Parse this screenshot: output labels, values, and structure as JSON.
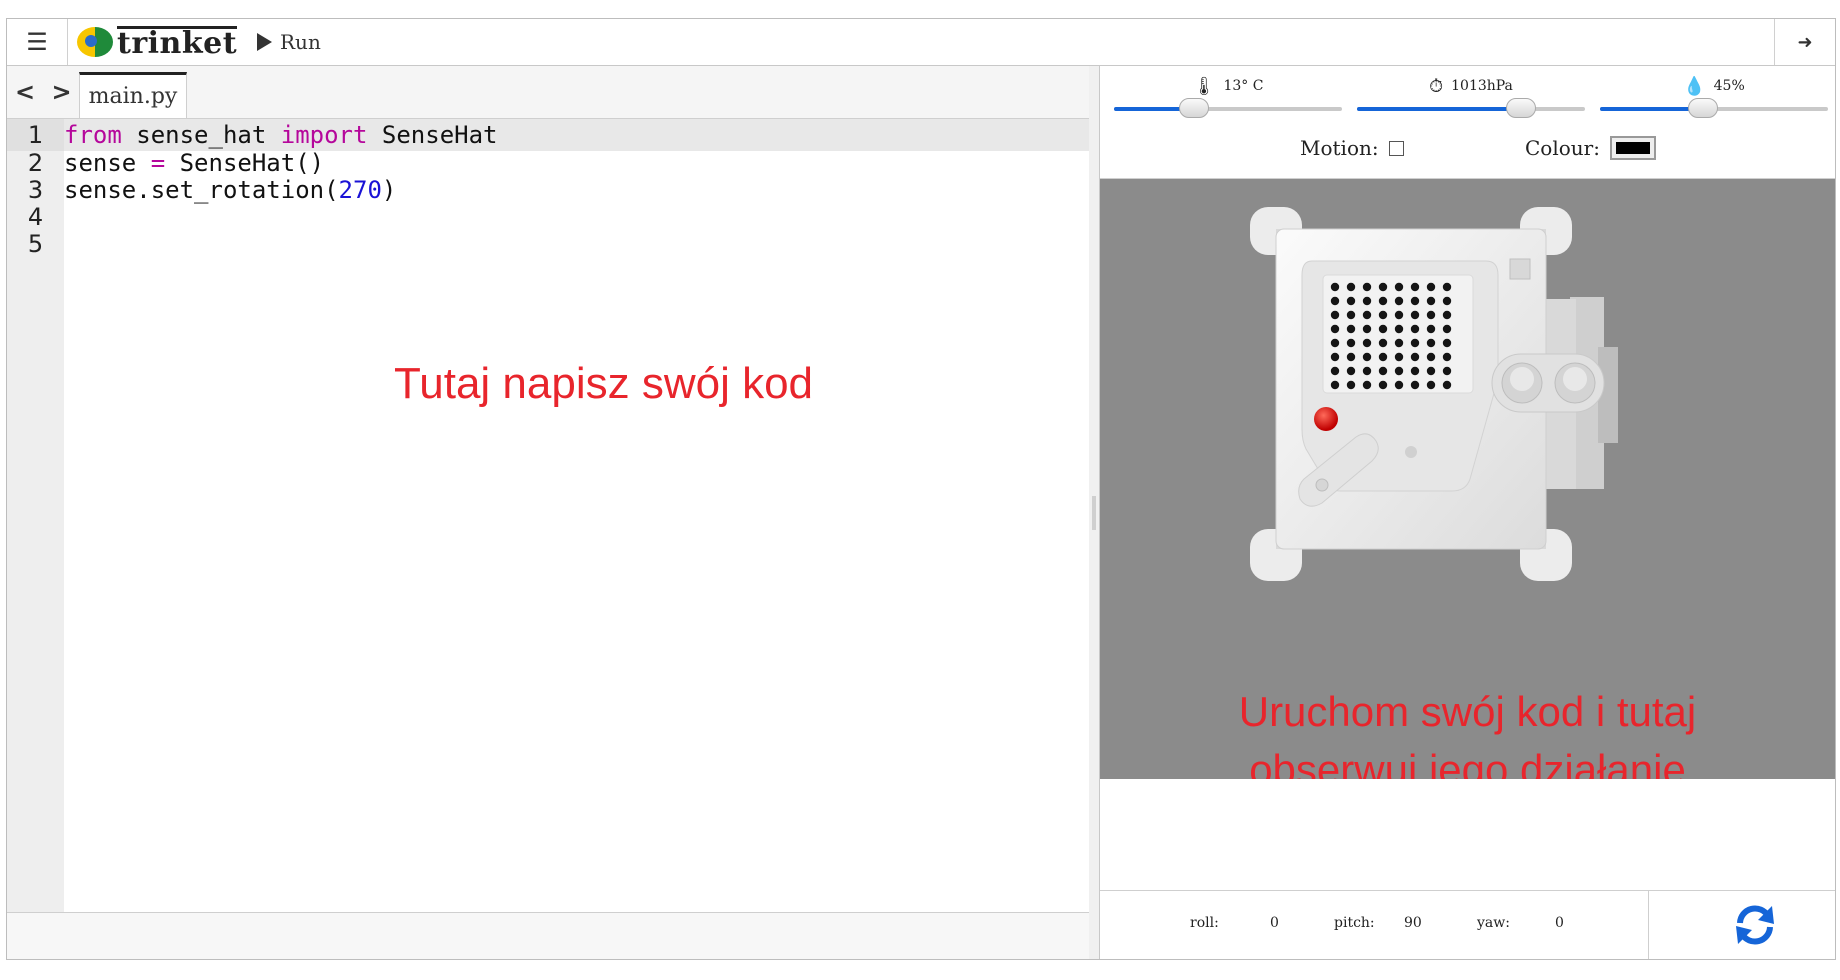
{
  "app": {
    "menu_icon": "hamburger-icon",
    "brand": "trinket",
    "run_label": "Run",
    "login_icon": "sign-in-icon"
  },
  "editor": {
    "nav_arrows": "< >",
    "file_tab": "main.py",
    "lines": [
      {
        "num": "1"
      },
      {
        "num": "2"
      },
      {
        "num": "3"
      },
      {
        "num": "4"
      },
      {
        "num": "5"
      }
    ],
    "code": {
      "l1_from": "from",
      "l1_mod": " sense_hat ",
      "l1_import": "import",
      "l1_cls": " SenseHat",
      "l2_a": "sense ",
      "l2_op": "=",
      "l2_b": " SenseHat()",
      "l3_a": "sense.set_rotation(",
      "l3_num": "270",
      "l3_b": ")"
    },
    "overlay_text": "Tutaj napisz swój kod"
  },
  "sensors": {
    "temperature": {
      "label": "13° C",
      "icon": "thermometer-icon",
      "level": 0.35
    },
    "pressure": {
      "label": "1013hPa",
      "icon": "gauge-icon",
      "level": 0.72
    },
    "humidity": {
      "label": "45%",
      "icon": "humidity-drop-icon",
      "level": 0.45
    },
    "motion_label": "Motion:",
    "colour_label": "Colour:",
    "colour_value": "#000000"
  },
  "viewport": {
    "overlay_line1": "Uruchom swój kod i tutaj",
    "overlay_line2": "obserwuj jego działanie"
  },
  "orientation": {
    "roll_label": "roll:",
    "roll_value": "0",
    "pitch_label": "pitch:",
    "pitch_value": "90",
    "yaw_label": "yaw:",
    "yaw_value": "0",
    "reset_icon": "refresh-icon"
  },
  "colors": {
    "accent_blue": "#1565d8",
    "overlay_red": "#e8252c",
    "keyword": "#b5079b",
    "number": "#1a12d6"
  }
}
